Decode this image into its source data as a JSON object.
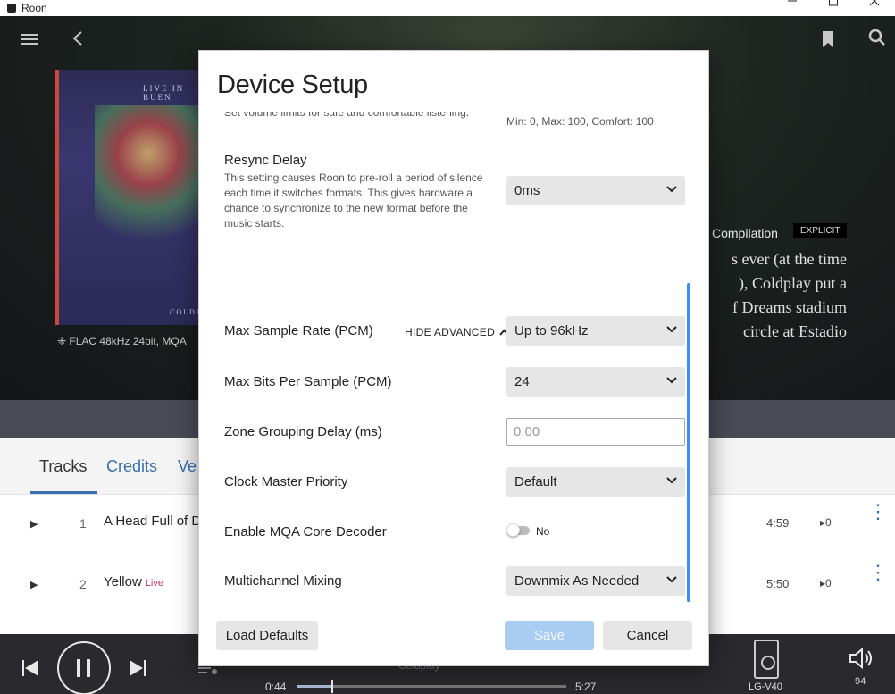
{
  "window": {
    "title": "Roon",
    "controls": [
      "minimize",
      "maximize",
      "close"
    ]
  },
  "hero": {
    "format": "FLAC 48kHz 24bit, MQA",
    "album_art_top": "LIVE IN BUEN",
    "album_art_bottom": "COLDPL",
    "tag": "Compilation",
    "badge": "EXPLICIT",
    "review_lines": [
      "s ever (at the time",
      "), Coldplay put a",
      "f Dreams stadium",
      "circle at Estadio"
    ]
  },
  "tabs": [
    {
      "label": "Tracks",
      "active": true
    },
    {
      "label": "Credits",
      "active": false
    },
    {
      "label": "Ve",
      "active": false
    }
  ],
  "tracks": [
    {
      "num": "1",
      "title": "A Head Full of D",
      "live": "",
      "duration": "4:59",
      "plays": "0"
    },
    {
      "num": "2",
      "title": "Yellow",
      "live": "Live",
      "duration": "5:50",
      "plays": "0"
    }
  ],
  "player": {
    "elapsed": "0:44",
    "total": "5:27",
    "artist": "Coldplay",
    "progress_fraction": 0.13,
    "device": "LG-V40",
    "volume": "94"
  },
  "dialog": {
    "title": "Device Setup",
    "cut_text": "Set volume limits for safe and comfortable listening.",
    "cut_value": "Min: 0, Max: 100, Comfort: 100",
    "resync": {
      "label": "Resync Delay",
      "description": "This setting causes Roon to pre-roll a period of silence each time it switches formats. This gives hardware a chance to synchronize to the new format before the music starts.",
      "value": "0ms"
    },
    "advanced_toggle": "HIDE ADVANCED",
    "settings": {
      "max_sample_rate": {
        "label": "Max Sample Rate (PCM)",
        "value": "Up to 96kHz"
      },
      "max_bits": {
        "label": "Max Bits Per Sample (PCM)",
        "value": "24"
      },
      "zone_grouping": {
        "label": "Zone Grouping Delay (ms)",
        "placeholder": "0.00"
      },
      "clock_master": {
        "label": "Clock Master Priority",
        "value": "Default"
      },
      "mqa_decoder": {
        "label": "Enable MQA Core Decoder",
        "value": "No"
      },
      "multichannel": {
        "label": "Multichannel Mixing",
        "value": "Downmix As Needed"
      }
    },
    "buttons": {
      "load_defaults": "Load Defaults",
      "save": "Save",
      "cancel": "Cancel"
    }
  }
}
